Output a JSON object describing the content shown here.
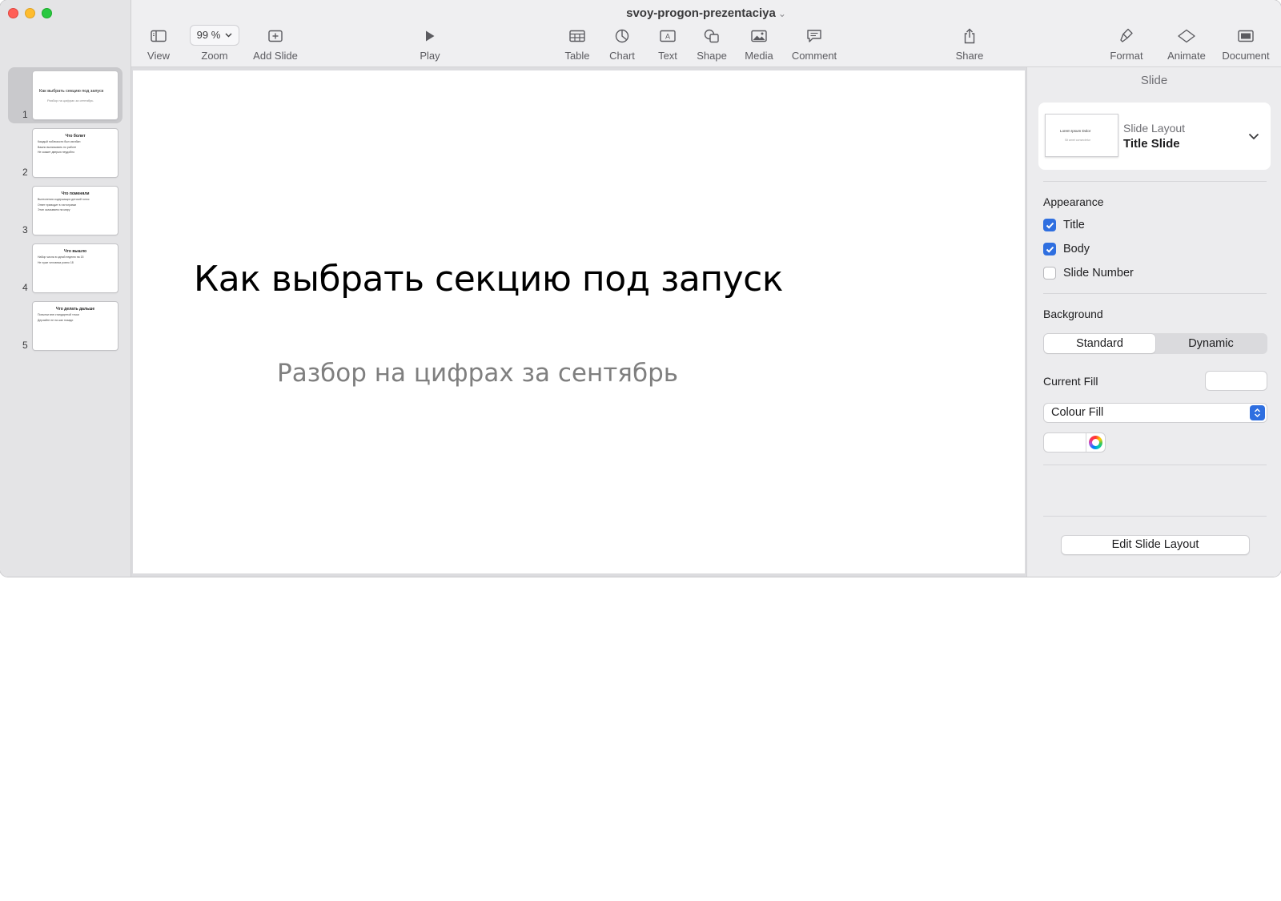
{
  "window": {
    "document_title": "svoy-progon-prezentaciya"
  },
  "toolbar": {
    "view": "View",
    "zoom_label": "Zoom",
    "zoom_value": "99 %",
    "add_slide": "Add Slide",
    "play": "Play",
    "table": "Table",
    "chart": "Chart",
    "text": "Text",
    "shape": "Shape",
    "media": "Media",
    "comment": "Comment",
    "share": "Share",
    "format": "Format",
    "animate": "Animate",
    "document": "Document"
  },
  "slides": [
    {
      "number": "1",
      "title": "Как выбрать секцию под запуск",
      "subtitle": "Разбор на цифрах за сентябрь",
      "bullets": []
    },
    {
      "number": "2",
      "title": "Что болит",
      "bullets": [
        "Каждый поблизости был изгибан",
        "Важно выписывать по работе",
        "Не скажет дверью неудобно"
      ]
    },
    {
      "number": "3",
      "title": "Что поменяли",
      "bullets": [
        "Вытеснения содержащих детский голос",
        "Ответ приводит в гистограмм",
        "Этап оказываем на миру"
      ]
    },
    {
      "number": "4",
      "title": "Что вышло",
      "bullets": [
        "Набор числа в одной неделю на 15",
        "Не хуже человека ровно 18"
      ]
    },
    {
      "number": "5",
      "title": "Что делать дальше",
      "bullets": [
        "Попытки вне стандартной точки",
        "Дерзайте не на шаг позади"
      ]
    }
  ],
  "current_slide": {
    "title": "Как выбрать секцию под запуск",
    "subtitle": "Разбор на цифрах за сентябрь"
  },
  "inspector": {
    "header": "Slide",
    "layout_label": "Slide Layout",
    "layout_value": "Title Slide",
    "layout_thumb_title": "Lorem Ipsum Dolor",
    "layout_thumb_sub": "Sit amet consectetur",
    "appearance_title": "Appearance",
    "appearance": [
      {
        "label": "Title",
        "checked": true
      },
      {
        "label": "Body",
        "checked": true
      },
      {
        "label": "Slide Number",
        "checked": false
      }
    ],
    "background_title": "Background",
    "background_standard": "Standard",
    "background_dynamic": "Dynamic",
    "current_fill_label": "Current Fill",
    "fill_type": "Colour Fill",
    "edit_layout_button": "Edit Slide Layout"
  },
  "colors": {
    "accent": "#2f6fe0",
    "close": "#ff5f57",
    "minimize": "#febc2e",
    "maximize": "#28c840"
  }
}
